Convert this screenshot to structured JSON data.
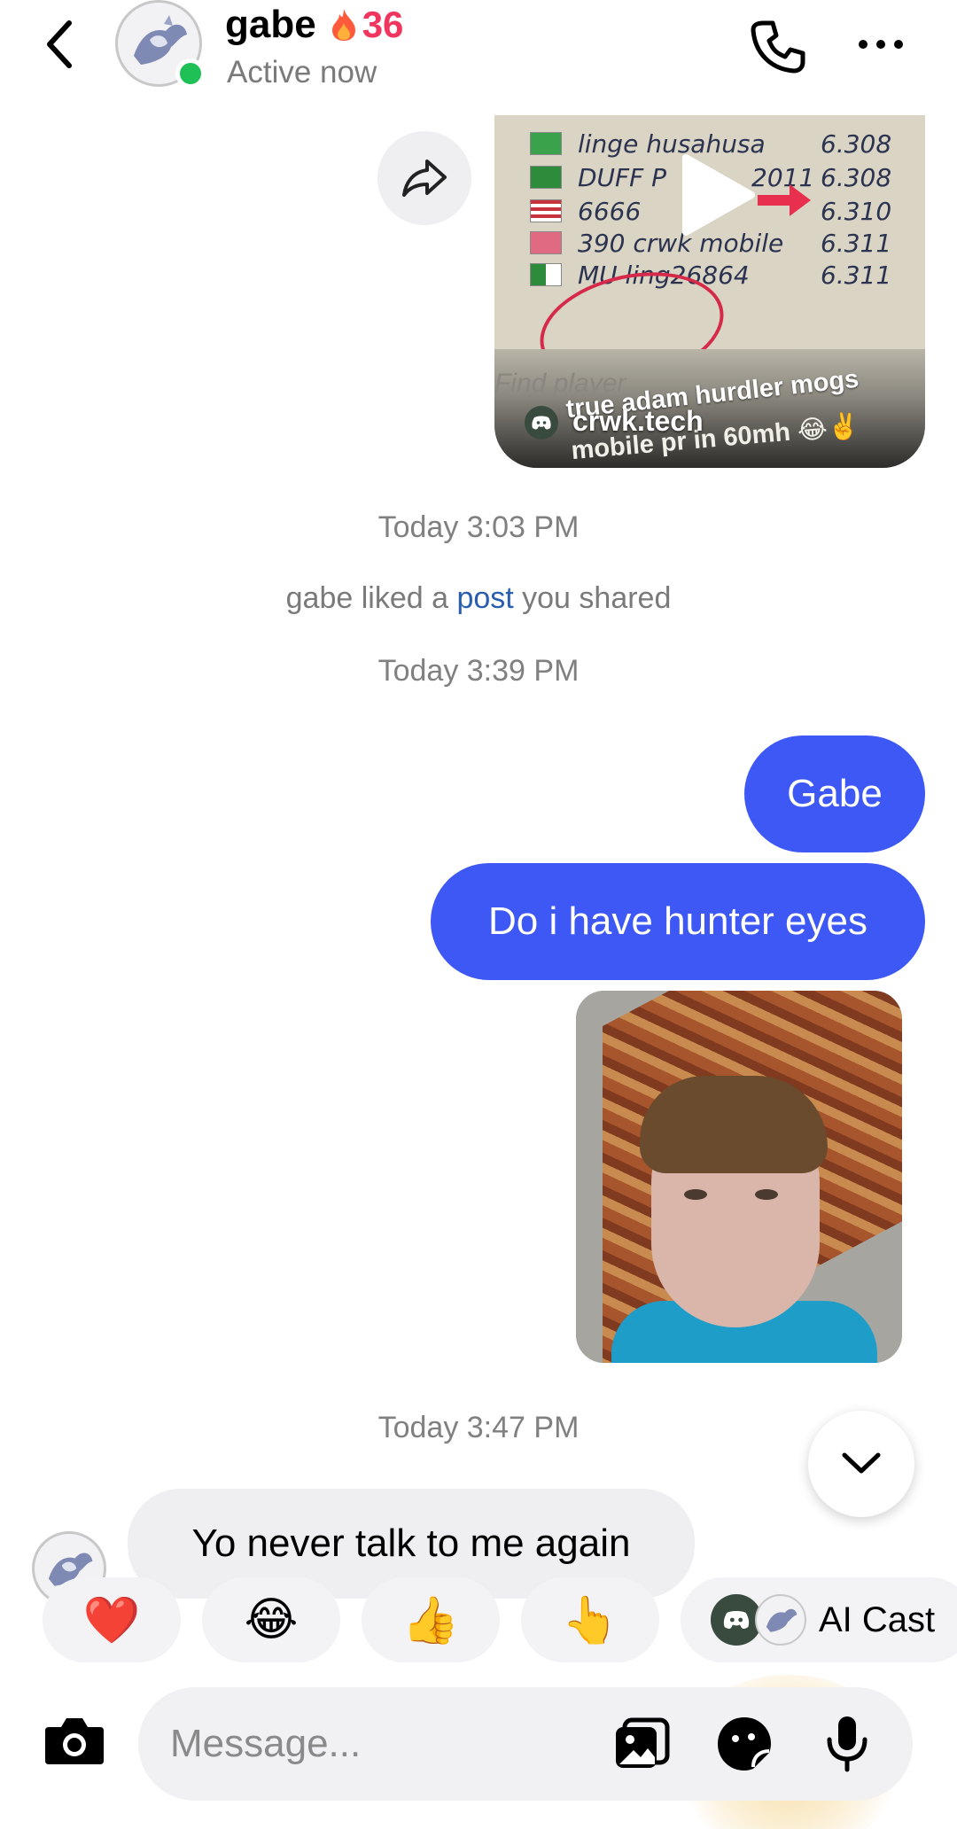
{
  "header": {
    "contact_name": "gabe",
    "streak_count": "36",
    "status": "Active now",
    "icons": [
      "back-arrow-icon",
      "flame-icon",
      "phone-icon",
      "more-icon"
    ]
  },
  "shared_video": {
    "leaderboard": [
      {
        "name": "linge husahusa",
        "score": "6.308"
      },
      {
        "name": "DUFF P",
        "score": "6.308"
      },
      {
        "name": "6666",
        "score": "6.310"
      },
      {
        "name": "390 crwk mobile",
        "score": "6.311"
      },
      {
        "name": "MU ling26864",
        "score": "6.311"
      }
    ],
    "partial_text_2011": "2011",
    "find_player": "Find player",
    "caption_line_1": "true adam hurdler mogs",
    "caption_line_2": "mobile pr in 60mh 😂✌️",
    "handle": "crwk.tech"
  },
  "thread": {
    "timestamp_1": "Today 3:03 PM",
    "system_prefix": "gabe liked a ",
    "system_link": "post",
    "system_suffix": " you shared",
    "timestamp_2": "Today 3:39 PM",
    "msg_out_1": "Gabe",
    "msg_out_2": "Do i have hunter eyes",
    "timestamp_3": "Today 3:47 PM",
    "msg_in_1": "Yo never talk to me again"
  },
  "reactions": {
    "items": [
      "❤️",
      "😂",
      "👍",
      "👆"
    ],
    "ai_label": "AI Cast"
  },
  "composer": {
    "placeholder": "Message..."
  },
  "colors": {
    "outgoing_bubble": "#3d58f5",
    "incoming_bubble": "#efeff1",
    "streak": "#f0365f",
    "online": "#1fc157",
    "link": "#2a5db0"
  }
}
